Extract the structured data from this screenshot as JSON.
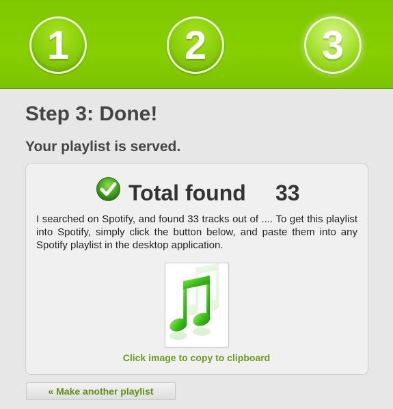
{
  "steps": [
    {
      "label": "1",
      "active": false
    },
    {
      "label": "2",
      "active": false
    },
    {
      "label": "3",
      "active": true
    }
  ],
  "page": {
    "title": "Step 3: Done!",
    "subtitle": "Your playlist is served."
  },
  "result": {
    "total_label": "Total found",
    "total_count": "33",
    "description": "I searched on Spotify, and found 33 tracks out of .... To get this playlist into Spotify, simply click the button below, and paste them into any Spotify playlist in the desktop application.",
    "copy_label": "Click image to copy to clipboard",
    "thumbnail_icon": "music-note-icon"
  },
  "actions": {
    "make_another_label": "« Make another playlist"
  },
  "colors": {
    "header_green": "#86cf00",
    "accent_green": "#6a9a1a",
    "check_green": "#4aa820"
  }
}
